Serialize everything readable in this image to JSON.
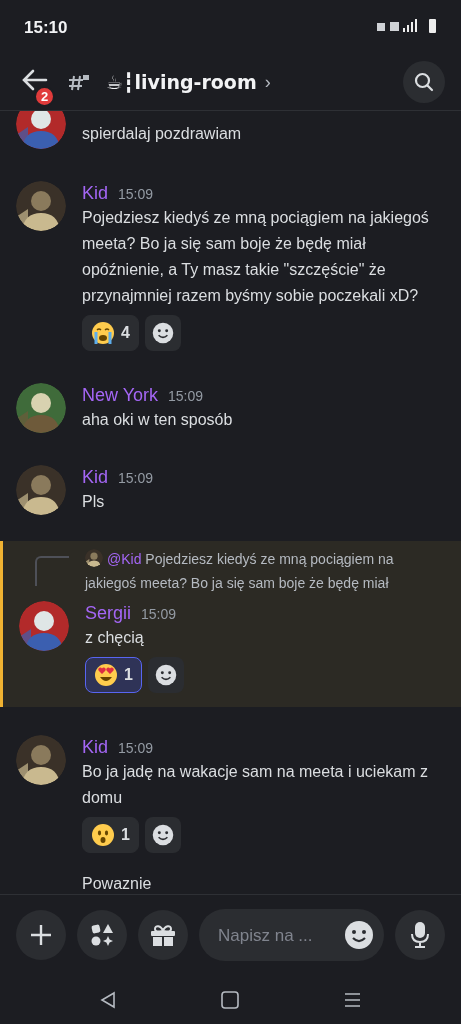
{
  "status_bar": {
    "time": "15:10"
  },
  "header": {
    "unread_count": "2",
    "channel_name": "☕┇living-room",
    "chevron": "›"
  },
  "messages": [
    {
      "kind": "partial",
      "avatar": {
        "kind": "blue-red"
      },
      "text": "spierdalaj pozdrawiam"
    },
    {
      "kind": "full",
      "avatar": {
        "kind": "dark"
      },
      "author": "Kid",
      "time": "15:09",
      "text": "Pojedziesz kiedyś ze mną pociągiem na jakiegoś meeta? Bo ja się sam boje że będę miał opóźnienie, a Ty masz takie \"szczęście\" że przynajmniej razem byśmy sobie poczekali xD?",
      "reactions": [
        {
          "kind": "crying",
          "count": "4",
          "selected": false
        }
      ]
    },
    {
      "kind": "full",
      "avatar": {
        "kind": "green"
      },
      "author": "New York",
      "time": "15:09",
      "text": "aha oki w ten sposób"
    },
    {
      "kind": "full",
      "avatar": {
        "kind": "dark"
      },
      "author": "Kid",
      "time": "15:09",
      "text": "Pls"
    },
    {
      "kind": "full",
      "avatar": {
        "kind": "blue-red"
      },
      "author": "Sergii",
      "time": "15:09",
      "text": "z chęcią",
      "highlighted": true,
      "reply": {
        "mention": "@Kid",
        "text": "Pojedziesz kiedyś ze mną pociągiem na jakiegoś meeta? Bo ja się sam boje że będę miał"
      },
      "reactions": [
        {
          "kind": "heart-eyes",
          "count": "1",
          "selected": true
        }
      ]
    },
    {
      "kind": "full",
      "avatar": {
        "kind": "dark"
      },
      "author": "Kid",
      "time": "15:09",
      "text": "Bo ja jadę na wakacje sam na meeta i uciekam z domu",
      "reactions": [
        {
          "kind": "astonished",
          "count": "1",
          "selected": false
        }
      ]
    },
    {
      "kind": "continuation",
      "text": "Powaznie"
    }
  ],
  "composer": {
    "placeholder": "Napisz na ..."
  }
}
